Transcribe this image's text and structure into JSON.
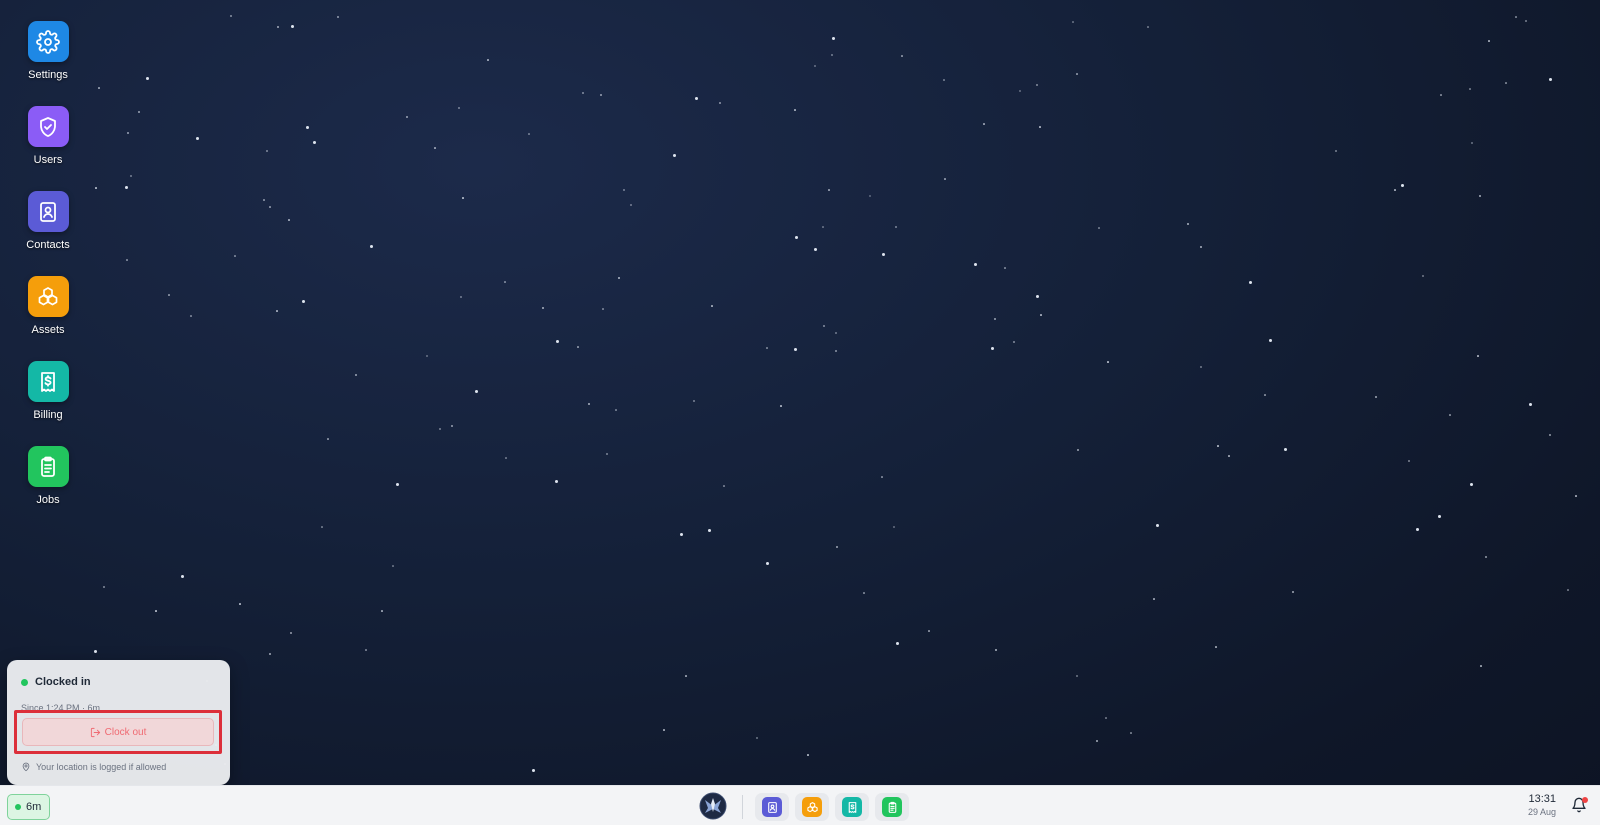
{
  "desktop_icons": [
    {
      "label": "Settings",
      "icon": "gear-icon",
      "color": "#1e88e5"
    },
    {
      "label": "Users",
      "icon": "shield-check-icon",
      "color": "#8b5cf6"
    },
    {
      "label": "Contacts",
      "icon": "contact-book-icon",
      "color": "#5b5bd6"
    },
    {
      "label": "Assets",
      "icon": "cubes-icon",
      "color": "#f59e0b"
    },
    {
      "label": "Billing",
      "icon": "dollar-receipt-icon",
      "color": "#14b8a6"
    },
    {
      "label": "Jobs",
      "icon": "clipboard-list-icon",
      "color": "#22c55e"
    }
  ],
  "clock_popup": {
    "title": "Clocked in",
    "since": "Since 1:24 PM · 6m",
    "clock_out_label": "Clock out",
    "location_note": "Your location is logged if allowed",
    "status_color": "#22c55e"
  },
  "taskbar": {
    "timer_label": "6m",
    "time": "13:31",
    "date": "29 Aug",
    "pinned_apps": [
      {
        "name": "Contacts",
        "icon": "contact-book-icon",
        "color": "#5b5bd6"
      },
      {
        "name": "Assets",
        "icon": "cubes-icon",
        "color": "#f59e0b"
      },
      {
        "name": "Billing",
        "icon": "dollar-receipt-icon",
        "color": "#14b8a6"
      },
      {
        "name": "Jobs",
        "icon": "clipboard-list-icon",
        "color": "#22c55e"
      }
    ]
  }
}
